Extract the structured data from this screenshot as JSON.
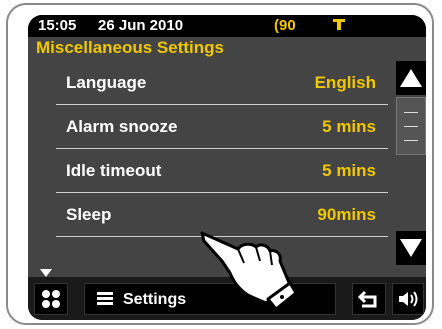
{
  "status_bar": {
    "time": "15:05",
    "date": "26 Jun 2010",
    "battery": "90"
  },
  "section_title": "Miscellaneous Settings",
  "settings": [
    {
      "label": "Language",
      "value": "English"
    },
    {
      "label": "Alarm snooze",
      "value": "5 mins"
    },
    {
      "label": "Idle timeout",
      "value": "5 mins"
    },
    {
      "label": "Sleep",
      "value": "90mins"
    }
  ],
  "bottom_bar": {
    "menu_label": "Settings"
  },
  "icons": {
    "battery": "battery-icon",
    "signal": "signal-icon",
    "scroll_up": "up-arrow-icon",
    "scroll_down": "down-arrow-icon",
    "home": "grid-home-icon",
    "menu": "hamburger-menu-icon",
    "back": "back-arrow-icon",
    "volume": "speaker-volume-icon",
    "pointer": "pointing-hand-icon"
  },
  "colors": {
    "accent": "#f0c800",
    "screen_bg": "#444444",
    "bar_bg": "#000000"
  }
}
